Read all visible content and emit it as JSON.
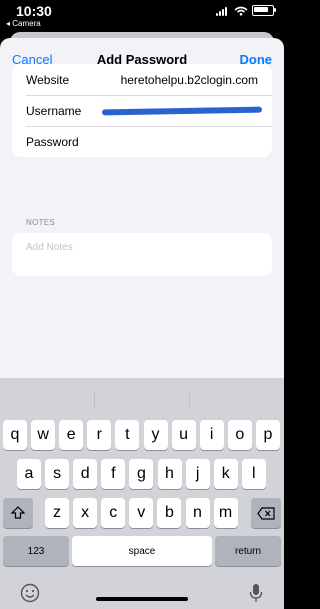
{
  "status_bar": {
    "time": "10:30",
    "back_app": "◂ Camera"
  },
  "nav": {
    "cancel": "Cancel",
    "title": "Add Password",
    "done": "Done"
  },
  "form": {
    "website_label": "Website",
    "website_value": "heretohelpu.b2clogin.com",
    "username_label": "Username",
    "password_label": "Password"
  },
  "notes": {
    "header": "NOTES",
    "placeholder": "Add Notes"
  },
  "keyboard": {
    "row1": [
      "q",
      "w",
      "e",
      "r",
      "t",
      "y",
      "u",
      "i",
      "o",
      "p"
    ],
    "row2": [
      "a",
      "s",
      "d",
      "f",
      "g",
      "h",
      "j",
      "k",
      "l"
    ],
    "row3": [
      "z",
      "x",
      "c",
      "v",
      "b",
      "n",
      "m"
    ],
    "numbers_key": "123",
    "space_key": "space",
    "return_key": "return"
  },
  "colors": {
    "accent": "#0a7aff",
    "redaction": "#2a62d1"
  },
  "icons": {
    "shift": "shift-icon",
    "delete": "delete-icon",
    "emoji": "emoji-icon",
    "mic": "microphone-icon"
  }
}
